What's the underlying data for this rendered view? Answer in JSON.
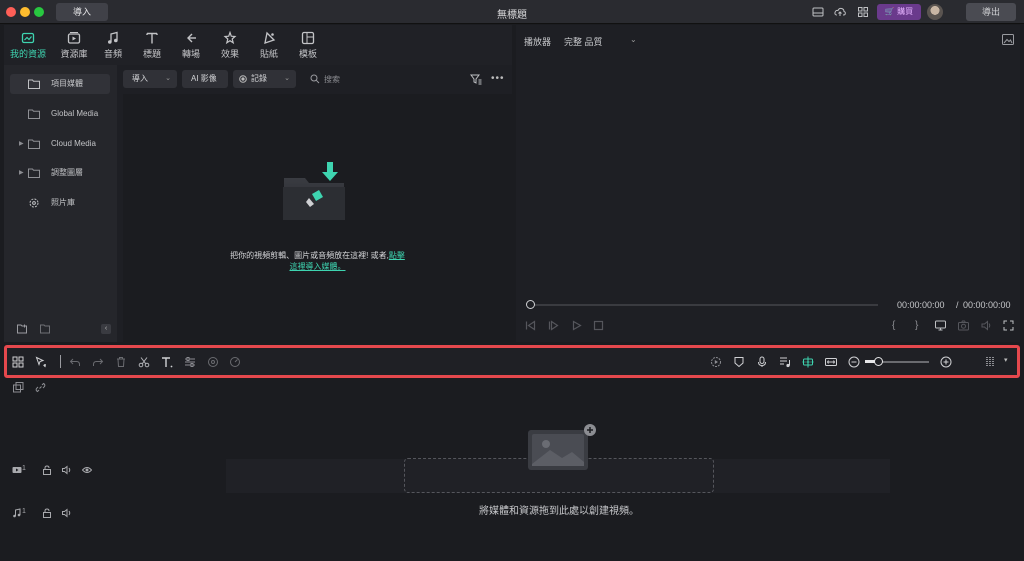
{
  "titlebar": {
    "import_label": "導入",
    "window_title": "無標題",
    "buy_label": "購買",
    "export_label": "導出"
  },
  "tabs": [
    {
      "label": "我的資源",
      "icon": "media-icon",
      "active": true
    },
    {
      "label": "資源庫",
      "icon": "library-icon",
      "active": false
    },
    {
      "label": "音頻",
      "icon": "music-icon",
      "active": false
    },
    {
      "label": "標題",
      "icon": "title-icon",
      "active": false
    },
    {
      "label": "轉場",
      "icon": "transition-icon",
      "active": false
    },
    {
      "label": "效果",
      "icon": "effects-icon",
      "active": false
    },
    {
      "label": "貼紙",
      "icon": "sticker-icon",
      "active": false
    },
    {
      "label": "模板",
      "icon": "template-icon",
      "active": false
    }
  ],
  "sidebar": {
    "items": [
      {
        "label": "項目媒體",
        "icon": "folder-icon",
        "expandable": false,
        "active": true
      },
      {
        "label": "Global Media",
        "icon": "folder-icon",
        "expandable": false,
        "active": false
      },
      {
        "label": "Cloud Media",
        "icon": "folder-icon",
        "expandable": true,
        "active": false
      },
      {
        "label": "調整圖層",
        "icon": "folder-icon",
        "expandable": true,
        "active": false
      },
      {
        "label": "照片庫",
        "icon": "flower-icon",
        "expandable": false,
        "active": false
      }
    ]
  },
  "library_toolbar": {
    "import_label": "導入",
    "ai_image_label": "AI 影像",
    "record_label": "記錄",
    "search_placeholder": "搜索"
  },
  "drop_area": {
    "line1_text": "把你的視頻剪輯、圖片或音頻放在這裡! 或者,",
    "link_part1": "點擊",
    "link_part2": "這裡導入媒體。"
  },
  "preview": {
    "player_label": "播放器",
    "quality_label": "完整 品質",
    "current_time": "00:00:00:00",
    "separator": "/",
    "total_time": "00:00:00:00"
  },
  "timeline_toolbar": {
    "zoom_level": 0.2
  },
  "timeline": {
    "tracks": [
      {
        "type": "video",
        "number": "1"
      },
      {
        "type": "audio",
        "number": "1"
      }
    ],
    "drop_text": "將媒體和資源拖到此處以創建視頻。"
  },
  "colors": {
    "accent": "#3ed4b0",
    "highlight_border": "#e5484d",
    "buy_bg": "#6a3a8c"
  }
}
